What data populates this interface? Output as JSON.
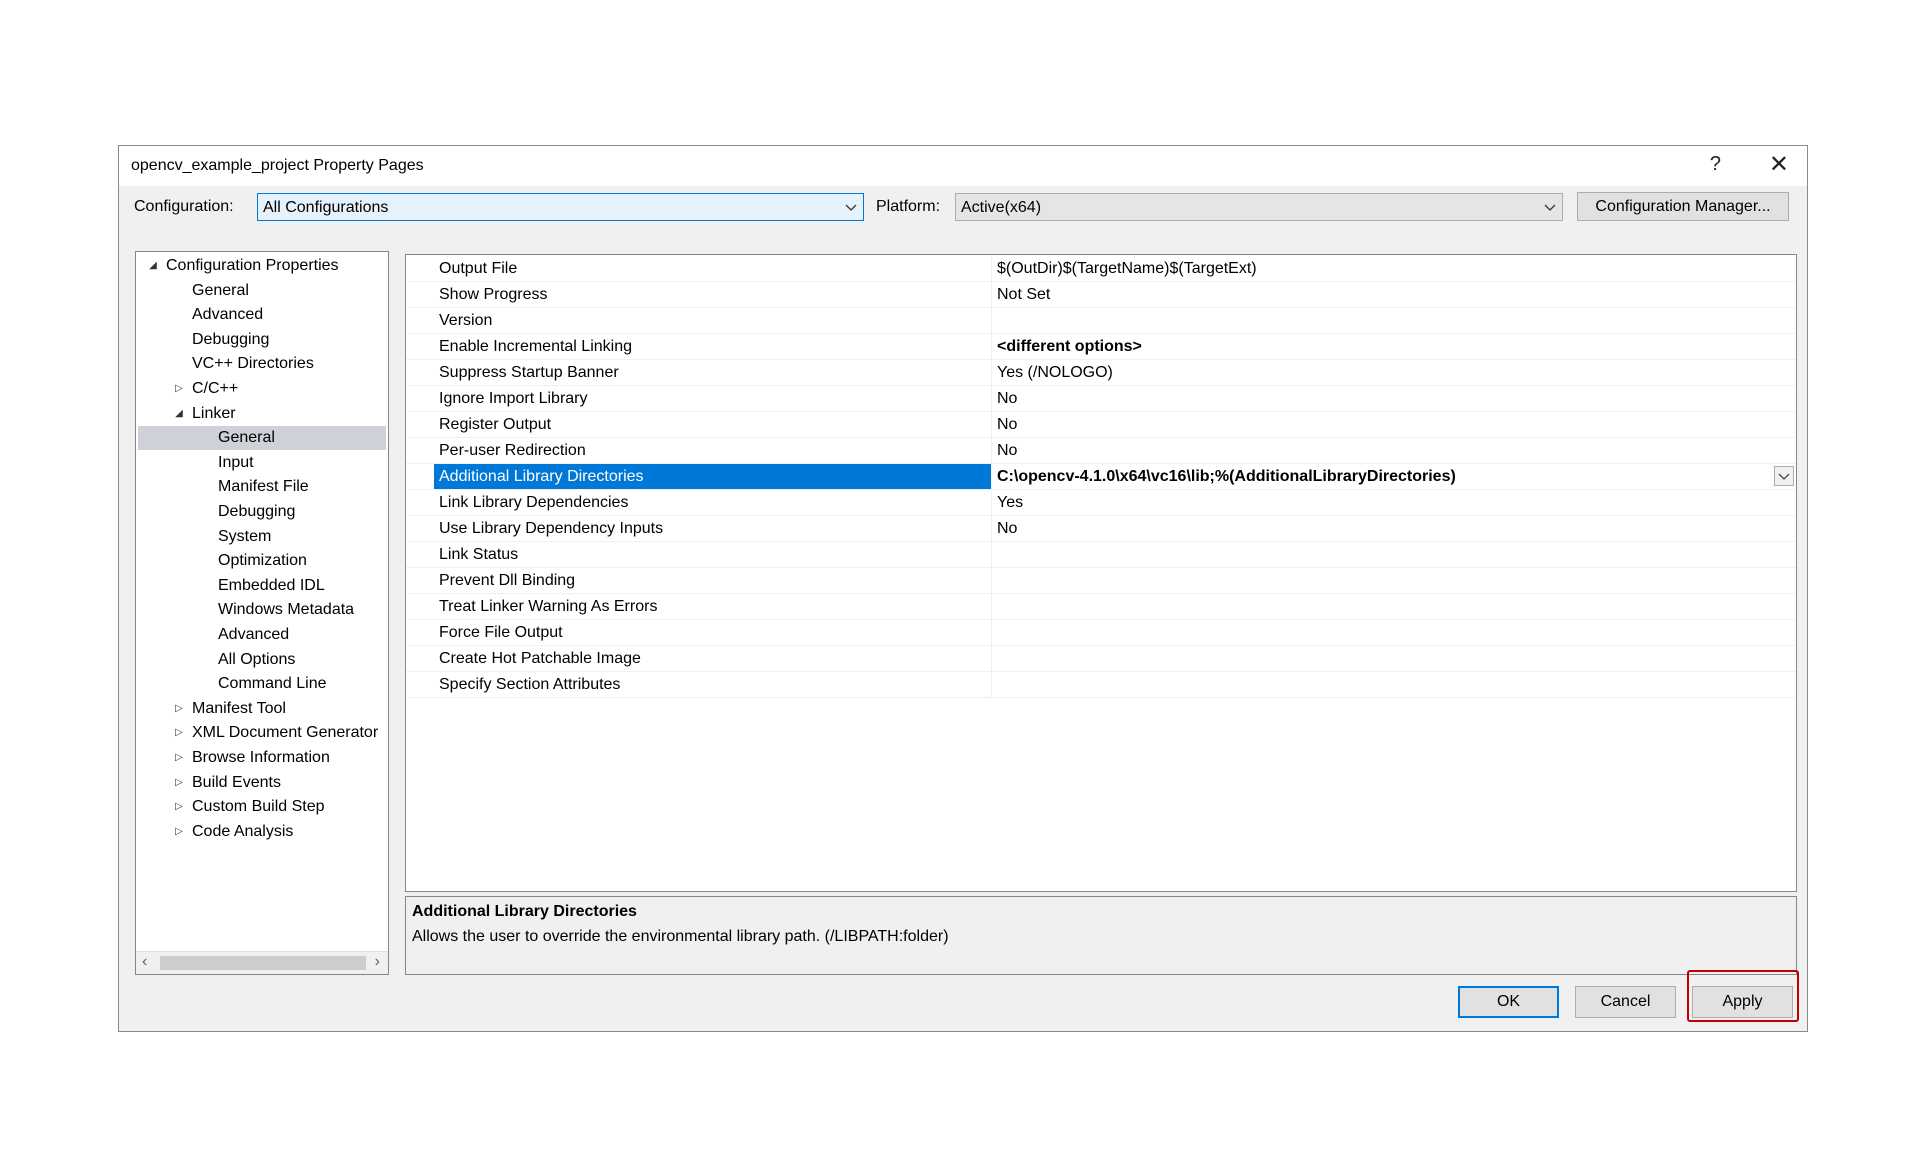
{
  "window": {
    "title": "opencv_example_project Property Pages",
    "help_glyph": "?",
    "close_glyph": "✕"
  },
  "config_bar": {
    "configuration_label": "Configuration:",
    "configuration_value": "All Configurations",
    "platform_label": "Platform:",
    "platform_value": "Active(x64)",
    "config_manager_label": "Configuration Manager..."
  },
  "tree": {
    "items": [
      {
        "label": "Configuration Properties",
        "level": 0,
        "expander": "expanded"
      },
      {
        "label": "General",
        "level": 1,
        "expander": "none"
      },
      {
        "label": "Advanced",
        "level": 1,
        "expander": "none"
      },
      {
        "label": "Debugging",
        "level": 1,
        "expander": "none"
      },
      {
        "label": "VC++ Directories",
        "level": 1,
        "expander": "none"
      },
      {
        "label": "C/C++",
        "level": 1,
        "expander": "collapsed"
      },
      {
        "label": "Linker",
        "level": 1,
        "expander": "expanded"
      },
      {
        "label": "General",
        "level": 2,
        "expander": "none",
        "selected": true
      },
      {
        "label": "Input",
        "level": 2,
        "expander": "none"
      },
      {
        "label": "Manifest File",
        "level": 2,
        "expander": "none"
      },
      {
        "label": "Debugging",
        "level": 2,
        "expander": "none"
      },
      {
        "label": "System",
        "level": 2,
        "expander": "none"
      },
      {
        "label": "Optimization",
        "level": 2,
        "expander": "none"
      },
      {
        "label": "Embedded IDL",
        "level": 2,
        "expander": "none"
      },
      {
        "label": "Windows Metadata",
        "level": 2,
        "expander": "none"
      },
      {
        "label": "Advanced",
        "level": 2,
        "expander": "none"
      },
      {
        "label": "All Options",
        "level": 2,
        "expander": "none"
      },
      {
        "label": "Command Line",
        "level": 2,
        "expander": "none"
      },
      {
        "label": "Manifest Tool",
        "level": 1,
        "expander": "collapsed"
      },
      {
        "label": "XML Document Generator",
        "level": 1,
        "expander": "collapsed"
      },
      {
        "label": "Browse Information",
        "level": 1,
        "expander": "collapsed"
      },
      {
        "label": "Build Events",
        "level": 1,
        "expander": "collapsed"
      },
      {
        "label": "Custom Build Step",
        "level": 1,
        "expander": "collapsed"
      },
      {
        "label": "Code Analysis",
        "level": 1,
        "expander": "collapsed"
      }
    ]
  },
  "properties": [
    {
      "name": "Output File",
      "value": "$(OutDir)$(TargetName)$(TargetExt)"
    },
    {
      "name": "Show Progress",
      "value": "Not Set"
    },
    {
      "name": "Version",
      "value": ""
    },
    {
      "name": "Enable Incremental Linking",
      "value": "<different options>",
      "bold": true
    },
    {
      "name": "Suppress Startup Banner",
      "value": "Yes (/NOLOGO)"
    },
    {
      "name": "Ignore Import Library",
      "value": "No"
    },
    {
      "name": "Register Output",
      "value": "No"
    },
    {
      "name": "Per-user Redirection",
      "value": "No"
    },
    {
      "name": "Additional Library Directories",
      "value": "C:\\opencv-4.1.0\\x64\\vc16\\lib;%(AdditionalLibraryDirectories)",
      "bold": true,
      "selected": true
    },
    {
      "name": "Link Library Dependencies",
      "value": "Yes"
    },
    {
      "name": "Use Library Dependency Inputs",
      "value": "No"
    },
    {
      "name": "Link Status",
      "value": ""
    },
    {
      "name": "Prevent Dll Binding",
      "value": ""
    },
    {
      "name": "Treat Linker Warning As Errors",
      "value": ""
    },
    {
      "name": "Force File Output",
      "value": ""
    },
    {
      "name": "Create Hot Patchable Image",
      "value": ""
    },
    {
      "name": "Specify Section Attributes",
      "value": ""
    }
  ],
  "description": {
    "title": "Additional Library Directories",
    "text": "Allows the user to override the environmental library path. (/LIBPATH:folder)"
  },
  "buttons": {
    "ok": "OK",
    "cancel": "Cancel",
    "apply": "Apply"
  },
  "colors": {
    "selection": "#0078d7",
    "highlight_box": "#c00000"
  }
}
